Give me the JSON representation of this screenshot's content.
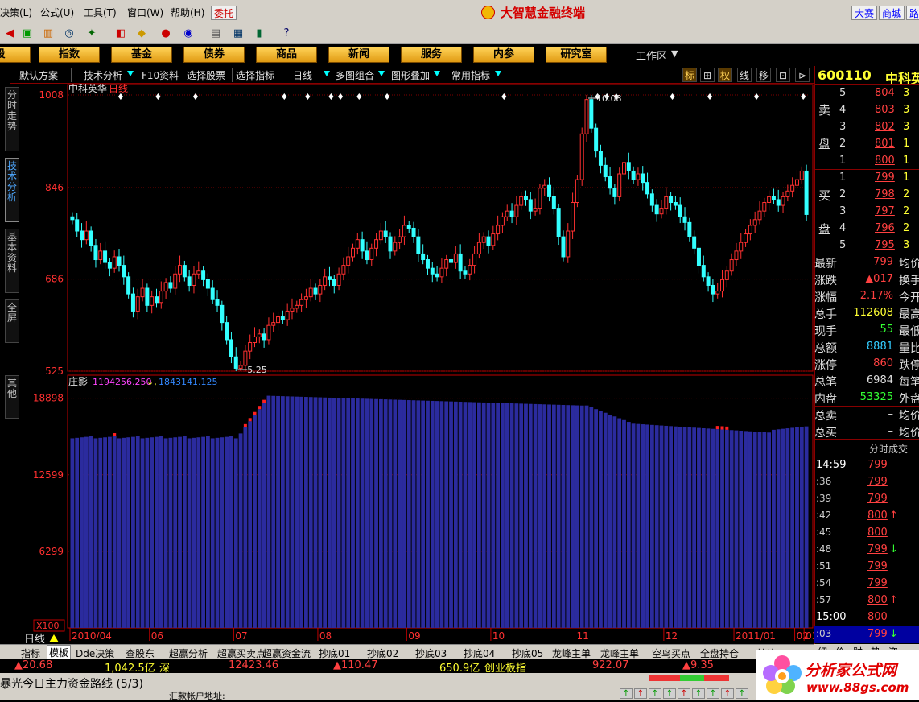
{
  "menubar": {
    "items": [
      "决策(L)",
      "公式(U)",
      "工具(T)",
      "窗口(W)",
      "帮助(H)"
    ],
    "trade_button": "委托",
    "app_title": "大智慧金融终端",
    "right_buttons": [
      "大赛",
      "商城",
      "路"
    ]
  },
  "toolbar": {
    "icons": [
      "exchange-icon",
      "chart-bars-icon",
      "binoculars-icon",
      "satellite-icon",
      "f10-icon",
      "diamond-icon",
      "news-icon",
      "link-icon",
      "clipboard-icon",
      "window-icon",
      "books-icon",
      "help-icon"
    ]
  },
  "categories": [
    "股",
    "指数",
    "基金",
    "债券",
    "商品",
    "新闻",
    "服务",
    "内参",
    "研究室"
  ],
  "workspace": "工作区",
  "left_tabs": [
    "分时走势",
    "技术分析",
    "基本资料",
    "全屏",
    "其他"
  ],
  "function_bar": {
    "items": [
      "默认方案",
      "技术分析",
      "F10资料",
      "选择股票",
      "选择指标",
      "日线",
      "多图组合",
      "图形叠加",
      "常用指标"
    ],
    "right_buttons": [
      "标",
      "⊞",
      "权",
      "线",
      "移",
      "⊡",
      "⊳"
    ]
  },
  "chart": {
    "title": "中科英华",
    "period_label": "日线",
    "cycle_label": "日线",
    "scale_label": "X100",
    "max_label": "10.08",
    "min_label": "5.25",
    "indicator_name": "庄影",
    "indicator_val1": "1194256.250",
    "indicator_val2": "1843141.125",
    "date_labels": [
      "2010/04",
      "06",
      "07",
      "08",
      "09",
      "10",
      "11",
      "12",
      "2011/01",
      "02",
      "03"
    ],
    "colors": {
      "up": "#ff3030",
      "down": "#33ffff",
      "grid": "#800000",
      "volume": "#2b2b9e",
      "axis": "#c00000"
    }
  },
  "chart_data": [
    {
      "type": "candlestick",
      "title": "中科英华 日线",
      "ylim": [
        5.25,
        10.08
      ],
      "yticks": [
        "1008",
        "846",
        "686",
        "525"
      ],
      "ytick_values": [
        10.08,
        8.46,
        6.86,
        5.25
      ],
      "x_labels": [
        "2010/04",
        "06",
        "07",
        "08",
        "09",
        "10",
        "11",
        "12",
        "2011/01",
        "02",
        "03"
      ],
      "close_series": [
        7.9,
        7.7,
        7.55,
        7.7,
        7.45,
        7.2,
        7.35,
        7.15,
        7.05,
        7.25,
        7.1,
        6.9,
        6.6,
        6.3,
        6.55,
        6.7,
        6.4,
        6.55,
        6.45,
        6.65,
        6.8,
        6.7,
        6.95,
        7.1,
        6.9,
        6.75,
        6.95,
        7.0,
        6.85,
        6.7,
        6.5,
        6.4,
        6.1,
        5.8,
        5.5,
        5.3,
        5.35,
        5.6,
        5.75,
        5.85,
        5.9,
        5.8,
        6.05,
        6.1,
        6.2,
        6.15,
        6.3,
        6.35,
        6.4,
        6.5,
        6.55,
        6.7,
        6.6,
        6.75,
        6.9,
        6.85,
        6.75,
        6.95,
        7.1,
        7.25,
        7.4,
        7.55,
        7.35,
        7.2,
        7.4,
        7.55,
        7.7,
        7.6,
        7.35,
        7.5,
        7.6,
        7.8,
        7.75,
        7.6,
        7.3,
        7.2,
        7.05,
        6.95,
        6.9,
        7.05,
        7.2,
        7.15,
        7.3,
        7.0,
        6.95,
        7.1,
        7.3,
        7.5,
        7.6,
        7.45,
        7.65,
        7.8,
        7.95,
        8.05,
        7.95,
        8.15,
        8.3,
        8.25,
        8.05,
        8.1,
        8.45,
        8.5,
        8.3,
        8.1,
        7.6,
        7.25,
        7.7,
        8.2,
        8.6,
        9.4,
        10.0,
        9.5,
        9.1,
        8.85,
        8.65,
        8.45,
        8.3,
        8.7,
        8.9,
        8.75,
        8.6,
        8.7,
        8.55,
        8.35,
        8.15,
        8.0,
        8.1,
        8.3,
        8.2,
        8.15,
        7.95,
        7.85,
        7.6,
        7.4,
        7.1,
        6.9,
        6.75,
        6.6,
        6.65,
        6.85,
        7.0,
        7.2,
        7.35,
        7.5,
        7.65,
        7.8,
        7.9,
        8.05,
        8.2,
        8.3,
        8.25,
        8.15,
        8.3,
        8.4,
        8.5,
        8.6,
        8.75,
        7.99
      ],
      "annotations": {
        "high": 10.08,
        "low": 5.25
      }
    },
    {
      "type": "bar",
      "title": "庄影",
      "yticks": [
        "18898",
        "12599",
        "6299"
      ],
      "ytick_values": [
        18898,
        12599,
        6299
      ],
      "series": [
        {
          "name": "庄影",
          "values": [
            1194256.25
          ]
        },
        {
          "name": "",
          "values": [
            1843141.125
          ]
        }
      ]
    }
  ],
  "quote": {
    "code": "600110",
    "name": "中科英华",
    "sell_label": [
      "卖",
      "盘"
    ],
    "buy_label": [
      "买",
      "盘"
    ],
    "sell_levels": [
      {
        "level": "5",
        "price": "804",
        "vol": "3"
      },
      {
        "level": "4",
        "price": "803",
        "vol": "3"
      },
      {
        "level": "3",
        "price": "802",
        "vol": "3"
      },
      {
        "level": "2",
        "price": "801",
        "vol": "1"
      },
      {
        "level": "1",
        "price": "800",
        "vol": "1"
      }
    ],
    "buy_levels": [
      {
        "level": "1",
        "price": "799",
        "vol": "1"
      },
      {
        "level": "2",
        "price": "798",
        "vol": "2"
      },
      {
        "level": "3",
        "price": "797",
        "vol": "2"
      },
      {
        "level": "4",
        "price": "796",
        "vol": "2"
      },
      {
        "level": "5",
        "price": "795",
        "vol": "3"
      }
    ],
    "stats": [
      {
        "label": "最新",
        "value": "799",
        "color": "#ff4040",
        "right": "均价"
      },
      {
        "label": "涨跌",
        "value": "▲017",
        "color": "#ff4040",
        "right": "换手"
      },
      {
        "label": "涨幅",
        "value": "2.17%",
        "color": "#ff4040",
        "right": "今开"
      },
      {
        "label": "总手",
        "value": "112608",
        "color": "#ffff33",
        "right": "最高"
      },
      {
        "label": "现手",
        "value": "55",
        "color": "#33ff33",
        "right": "最低"
      },
      {
        "label": "总额",
        "value": "8881",
        "color": "#33ccff",
        "right": "量比"
      },
      {
        "label": "涨停",
        "value": "860",
        "color": "#ff4040",
        "right": "跌停"
      },
      {
        "label": "总笔",
        "value": "6984",
        "color": "#dddddd",
        "right": "每笔"
      },
      {
        "label": "内盘",
        "value": "53325",
        "color": "#33ff33",
        "right": "外盘"
      },
      {
        "label": "总卖",
        "value": "–",
        "color": "#dddddd",
        "right": "均价"
      },
      {
        "label": "总买",
        "value": "–",
        "color": "#dddddd",
        "right": "均价"
      }
    ],
    "tick_header": "分时成交",
    "ticks": [
      {
        "time": "14:59",
        "price": "799",
        "arrow": ""
      },
      {
        "time": ":36",
        "price": "799",
        "arrow": ""
      },
      {
        "time": ":39",
        "price": "799",
        "arrow": ""
      },
      {
        "time": ":42",
        "price": "800",
        "arrow": "↑"
      },
      {
        "time": ":45",
        "price": "800",
        "arrow": ""
      },
      {
        "time": ":48",
        "price": "799",
        "arrow": "↓"
      },
      {
        "time": ":51",
        "price": "799",
        "arrow": ""
      },
      {
        "time": ":54",
        "price": "799",
        "arrow": ""
      },
      {
        "time": ":57",
        "price": "800",
        "arrow": "↑"
      },
      {
        "time": "15:00",
        "price": "800",
        "arrow": ""
      },
      {
        "time": ":03",
        "price": "799",
        "arrow": "↓"
      }
    ],
    "tabs": [
      "细",
      "价",
      "财",
      "势",
      "资"
    ]
  },
  "bottom_tabs": [
    "指标",
    "模板",
    "Dde决策",
    "查股东",
    "超赢分析",
    "超赢买卖点",
    "超赢资金流",
    "抄底01",
    "抄底02",
    "抄底03",
    "抄底04",
    "抄底05",
    "龙峰主单",
    "龙峰主单",
    "空鸟买点",
    "全盘持仓",
    "其他"
  ],
  "index_bar": {
    "sh_change": "▲20.68",
    "sh_amount": "1,042.5亿",
    "sz_label": "深",
    "sz_index": "12423.46",
    "sz_change": "▲110.47",
    "cy_amount": "650.9亿",
    "cy_label": "创业板指",
    "cy_index": "922.07",
    "cy_change": "▲9.35"
  },
  "status": {
    "ticker": "暴光今日主力资金路线 (5/3)",
    "hint": "汇款帐户地址:",
    "lamps": [
      "↑",
      "↑",
      "↑",
      "↑",
      "↑",
      "↑",
      "↑",
      "↑",
      "↑"
    ]
  },
  "watermark": {
    "title": "分析家公式网",
    "url": "www.88gs.com"
  }
}
